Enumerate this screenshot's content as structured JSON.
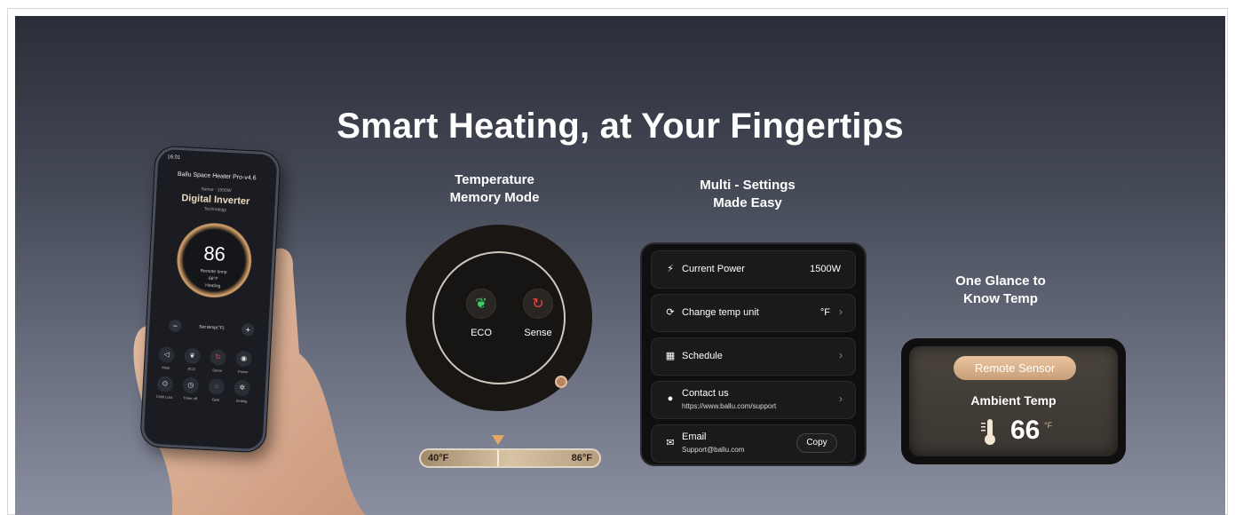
{
  "headline": "Smart Heating, at Your Fingertips",
  "captions": {
    "memory": [
      "Temperature",
      "Memory Mode"
    ],
    "settings": [
      "Multi - Settings",
      "Made Easy"
    ],
    "glance": [
      "One Glance to",
      "Know Temp"
    ]
  },
  "phone": {
    "status_time": "16:01",
    "app_title": "Ballu Space Heater Pro-v4.6",
    "sub_label": "Sense : 1500W",
    "brand": "Digital Inverter",
    "tech": "Technology",
    "temp": "86",
    "unit": "°F",
    "remote_label": "Remote temp",
    "remote_value": "68°F",
    "mode": "Heating",
    "set_label": "Set temp(°F)",
    "minus": "−",
    "plus": "+",
    "controls": [
      {
        "label": "Mute",
        "icon": "speaker-icon"
      },
      {
        "label": "ECO",
        "icon": "leaf-icon"
      },
      {
        "label": "Sense",
        "icon": "sense-icon"
      },
      {
        "label": "Power",
        "icon": "power-icon"
      },
      {
        "label": "Child Lock",
        "icon": "lock-icon"
      },
      {
        "label": "Timer off",
        "icon": "timer-icon"
      },
      {
        "label": "Gear",
        "icon": "gear-icon"
      },
      {
        "label": "Setting",
        "icon": "settings-icon"
      }
    ]
  },
  "dial": {
    "eco_label": "ECO",
    "sense_label": "Sense",
    "colors": {
      "eco": "#3ecf6a",
      "sense": "#e2453c"
    }
  },
  "slider": {
    "min_label": "40°F",
    "max_label": "86°F"
  },
  "settings": {
    "current_power": {
      "label": "Current Power",
      "value": "1500W"
    },
    "temp_unit": {
      "label": "Change temp unit",
      "value": "°F"
    },
    "schedule": {
      "label": "Schedule"
    },
    "contact": {
      "label": "Contact us",
      "sub": "https://www.ballu.com/support"
    },
    "email": {
      "label": "Email",
      "sub": "Support@ballu.com",
      "button": "Copy"
    }
  },
  "sensor": {
    "pill": "Remote Sensor",
    "title": "Ambient Temp",
    "temp": "66",
    "unit": "°F"
  }
}
